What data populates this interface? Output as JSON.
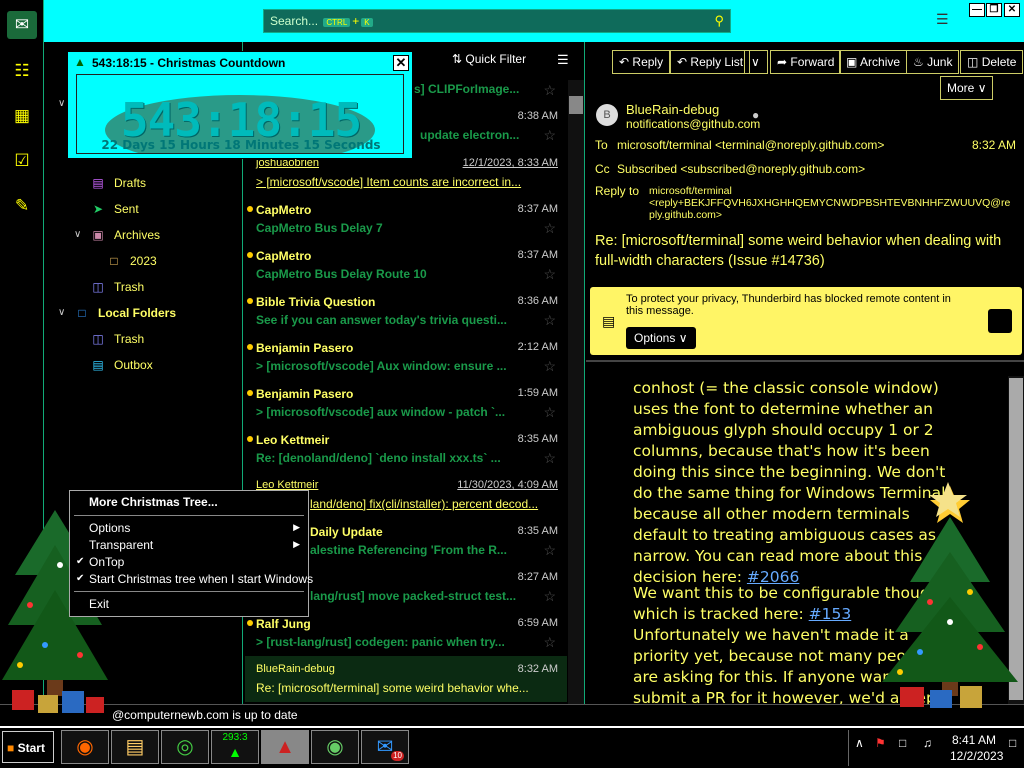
{
  "search": {
    "placeholder": "Search...",
    "shortcut_ctrl": "CTRL",
    "shortcut_plus": "+",
    "shortcut_key": "K"
  },
  "folders": [
    {
      "label": "Drafts",
      "icon": "drafts-icon"
    },
    {
      "label": "Sent",
      "icon": "sent-icon"
    },
    {
      "label": "Archives",
      "icon": "archives-icon"
    },
    {
      "label": "2023",
      "icon": "folder-icon"
    },
    {
      "label": "Trash",
      "icon": "trash-icon"
    },
    {
      "label": "Local Folders",
      "icon": "local-folders-icon"
    },
    {
      "label": "Trash",
      "icon": "trash-icon"
    },
    {
      "label": "Outbox",
      "icon": "outbox-icon"
    }
  ],
  "partial_folder": "...",
  "list_toolbar": {
    "quick_filter": "Quick Filter"
  },
  "messages": [
    {
      "sender": "",
      "subject": "s] CLIPForImage...",
      "date": ""
    },
    {
      "sender": "",
      "subject": "update electron...",
      "date": "8:38 AM"
    },
    {
      "sender": "joshuaobrien",
      "subject": "> [microsoft/vscode] Item counts are incorrect in...",
      "date": "12/1/2023, 8:33 AM"
    },
    {
      "sender": "CapMetro",
      "subject": "CapMetro Bus Delay 7",
      "date": "8:37 AM"
    },
    {
      "sender": "CapMetro",
      "subject": "CapMetro Bus Delay Route 10",
      "date": "8:37 AM"
    },
    {
      "sender": "Bible Trivia Question",
      "subject": "See if you can answer today's trivia questi...",
      "date": "8:36 AM"
    },
    {
      "sender": "Benjamin Pasero",
      "subject": "> [microsoft/vscode] Aux window: ensure ...",
      "date": "2:12 AM"
    },
    {
      "sender": "Benjamin Pasero",
      "subject": "> [microsoft/vscode] aux window - patch `...",
      "date": "1:59 AM"
    },
    {
      "sender": "Leo Kettmeir",
      "subject": "Re: [denoland/deno] `deno install xxx.ts` ...",
      "date": "8:35 AM"
    },
    {
      "sender": "Leo Kettmeir",
      "subject": "land/deno] fix(cli/installer): percent decod...",
      "date": "11/30/2023, 4:09 AM"
    },
    {
      "sender": "Daily Update",
      "subject": "alestine Referencing 'From the R...",
      "date": "8:35 AM"
    },
    {
      "sender": "",
      "subject": "lang/rust] move packed-struct test...",
      "date": "8:27 AM"
    },
    {
      "sender": "Ralf Jung",
      "subject": "> [rust-lang/rust] codegen: panic when try...",
      "date": "6:59 AM"
    },
    {
      "sender": "BlueRain-debug",
      "subject": "Re: [microsoft/terminal] some weird behavior whe...",
      "date": "8:32 AM"
    }
  ],
  "reader_toolbar": {
    "reply": "Reply",
    "reply_list": "Reply List",
    "forward": "Forward",
    "archive": "Archive",
    "junk": "Junk",
    "delete": "Delete",
    "more": "More"
  },
  "header": {
    "from_name": "BlueRain-debug",
    "from_email": "notifications@github.com",
    "avatar_letter": "B",
    "to_label": "To",
    "to_value": "microsoft/terminal <terminal@noreply.github.com>",
    "time": "8:32 AM",
    "cc_label": "Cc",
    "cc_value": "Subscribed <subscribed@noreply.github.com>",
    "replyto_label": "Reply to",
    "replyto_line1": "microsoft/terminal",
    "replyto_line2": "<reply+BEKJFFQVH6JXHGHHQEMYCNWDPBSHTEVBNHHFZWUUVQ@re",
    "replyto_line3": "ply.github.com>",
    "subject": "Re: [microsoft/terminal] some weird behavior when dealing with full-width characters (Issue #14736)"
  },
  "privacy": {
    "text": "To protect your privacy, Thunderbird has blocked remote content in this message.",
    "options": "Options"
  },
  "body": {
    "p1_text": "conhost (= the classic console window) uses the font to determine whether an ambiguous glyph should occupy 1 or 2 columns, because that's how it's been doing this since the beginning. We don't do the same thing for Windows Terminal, because all other modern terminals default to treating ambiguous cases as narrow. You can read more about this decision here: ",
    "p1_link": "#2066",
    "p2_text": "We want this to be configurable though, which is tracked here: ",
    "p2_link": "#153",
    "p2_rest": " Unfortunately we haven't made it a priority yet, because not many people are asking for this. If anyone wants to submit a PR for it however, we'd accept it in a heartbeat."
  },
  "countdown": {
    "title": "543:18:15 - Christmas Countdown",
    "big": "543:18:15",
    "small": "22 Days 15 Hours 18 Minutes 15 Seconds"
  },
  "context_menu": {
    "more": "More Christmas Tree...",
    "options": "Options",
    "transparent": "Transparent",
    "ontop": "OnTop",
    "start": "Start Christmas tree when I start Windows",
    "exit": "Exit"
  },
  "status": {
    "text": "@computernewb.com is up to date"
  },
  "taskbar": {
    "start": "Start",
    "countdown_badge": "293:3",
    "thunderbird_badge": "10",
    "time": "8:41 AM",
    "date": "12/2/2023"
  }
}
